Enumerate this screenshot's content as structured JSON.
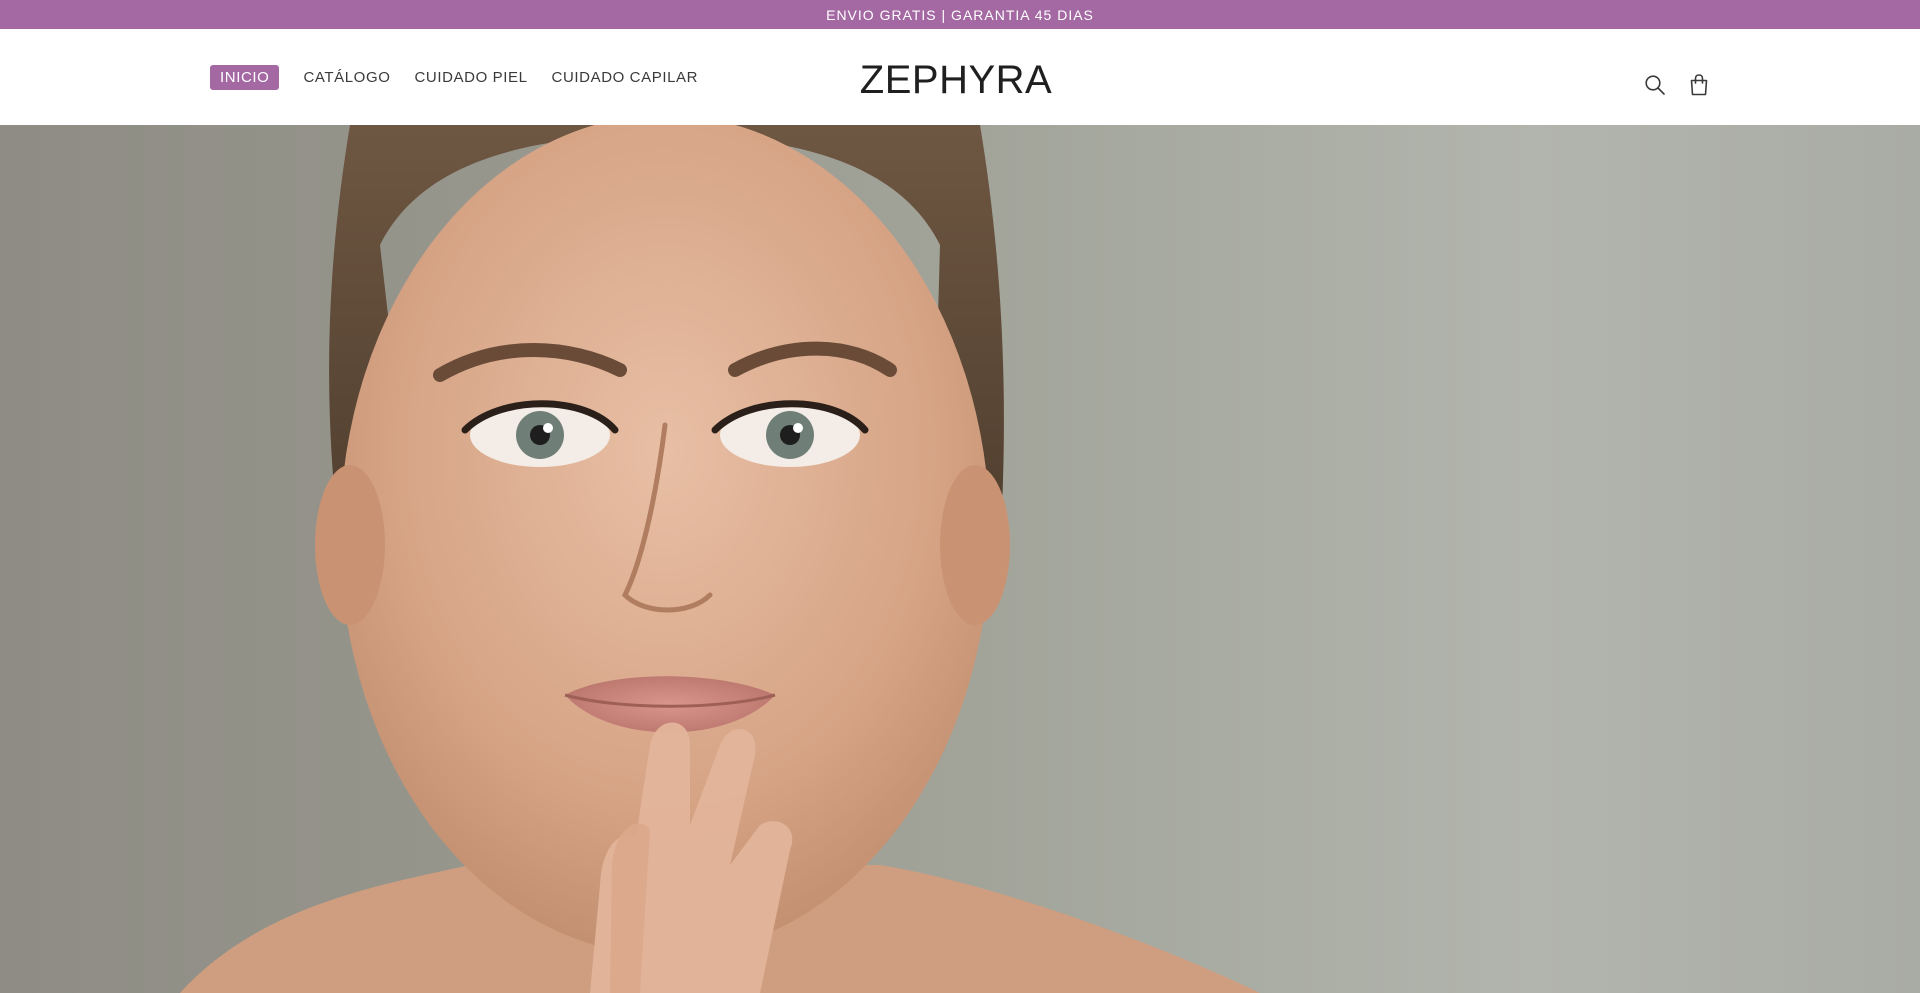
{
  "announcement": {
    "text": "ENVIO GRATIS | GARANTIA 45 DIAS",
    "bg_color": "#a468a3"
  },
  "header": {
    "nav": [
      {
        "label": "INICIO",
        "active": true
      },
      {
        "label": "CATÁLOGO",
        "active": false
      },
      {
        "label": "CUIDADO PIEL",
        "active": false
      },
      {
        "label": "CUIDADO CAPILAR",
        "active": false
      }
    ],
    "logo": "ZEPHYRA",
    "icons": [
      "search-icon",
      "bag-icon"
    ]
  },
  "hero": {
    "image": "woman-portrait-skincare"
  },
  "colors": {
    "accent": "#a468a3",
    "text": "#3a3a3a"
  }
}
